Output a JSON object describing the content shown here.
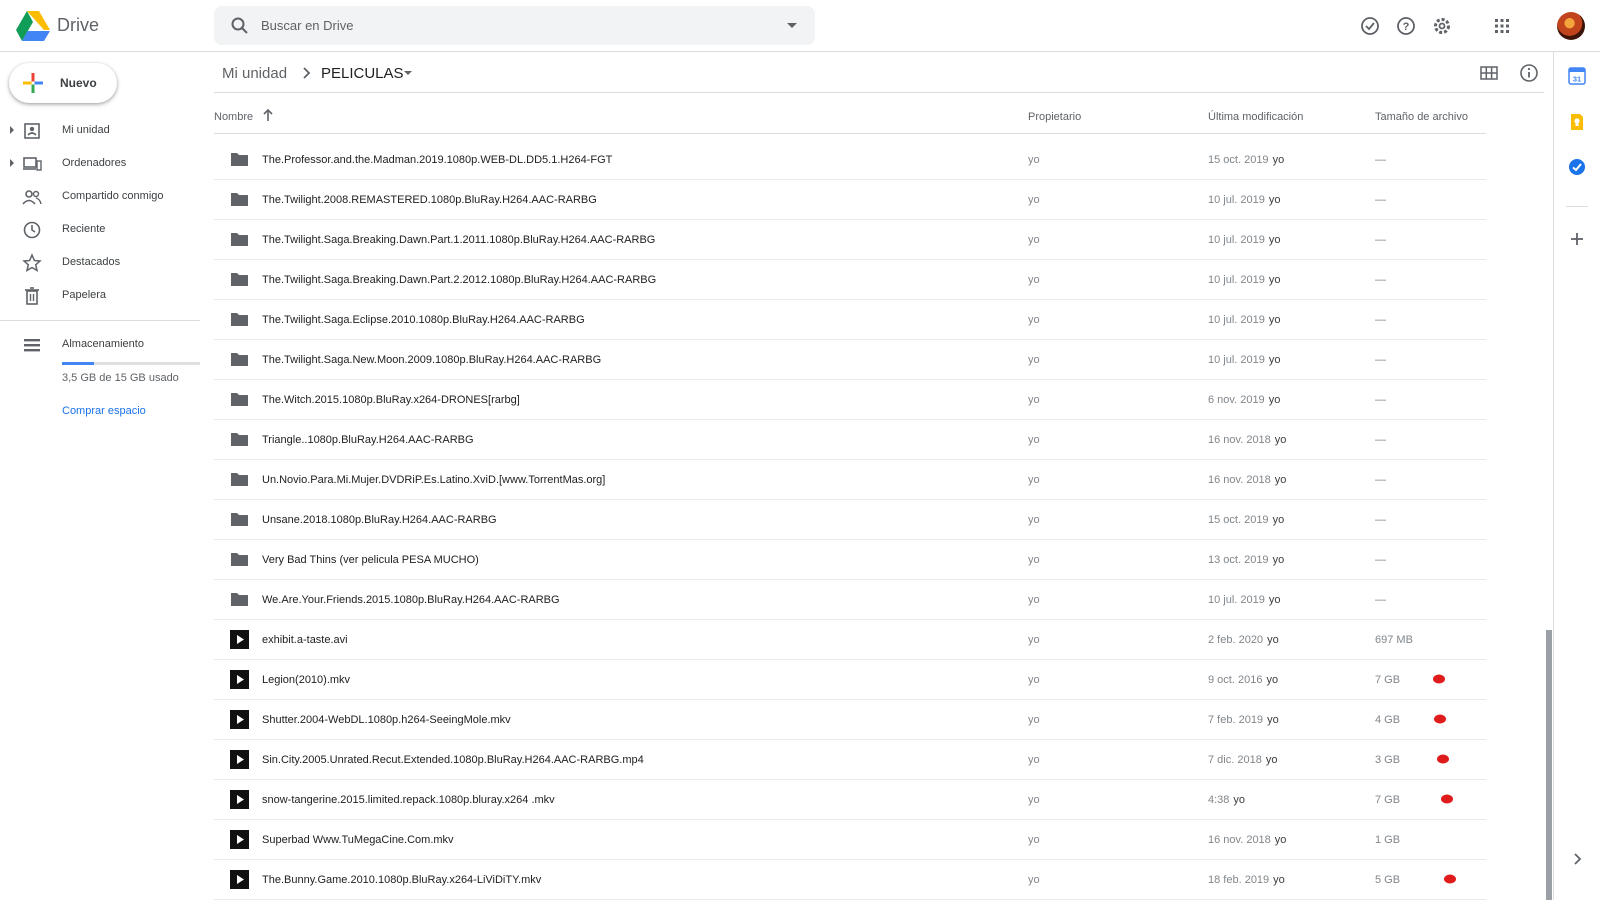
{
  "header": {
    "app_name": "Drive",
    "search_placeholder": "Buscar en Drive",
    "icons": [
      "support-check-icon",
      "help-icon",
      "settings-gear-icon",
      "apps-grid-icon",
      "account-avatar"
    ]
  },
  "sidebar": {
    "new_button": "Nuevo",
    "items": [
      {
        "label": "Mi unidad",
        "icon": "my-drive-icon",
        "expandable": true
      },
      {
        "label": "Ordenadores",
        "icon": "computers-icon",
        "expandable": true
      },
      {
        "label": "Compartido conmigo",
        "icon": "shared-people-icon",
        "expandable": false
      },
      {
        "label": "Reciente",
        "icon": "clock-icon",
        "expandable": false
      },
      {
        "label": "Destacados",
        "icon": "star-icon",
        "expandable": false
      },
      {
        "label": "Papelera",
        "icon": "trash-icon",
        "expandable": false
      }
    ],
    "storage": {
      "label": "Almacenamiento",
      "used_text": "3,5 GB de 15 GB usado",
      "used_fraction": 0.23,
      "buy_link": "Comprar espacio"
    }
  },
  "breadcrumb": {
    "root": "Mi unidad",
    "current": "PELICULAS"
  },
  "columns": {
    "name": "Nombre",
    "owner": "Propietario",
    "modified": "Última modificación",
    "size": "Tamaño de archivo"
  },
  "files": [
    {
      "type": "folder",
      "name": "The.Professor.and.the.Madman.2019.1080p.WEB-DL.DD5.1.H264-FGT",
      "owner": "yo",
      "date": "15 oct. 2019",
      "by": "yo",
      "size": "—"
    },
    {
      "type": "folder",
      "name": "The.Twilight.2008.REMASTERED.1080p.BluRay.H264.AAC-RARBG",
      "owner": "yo",
      "date": "10 jul. 2019",
      "by": "yo",
      "size": "—"
    },
    {
      "type": "folder",
      "name": "The.Twilight.Saga.Breaking.Dawn.Part.1.2011.1080p.BluRay.H264.AAC-RARBG",
      "owner": "yo",
      "date": "10 jul. 2019",
      "by": "yo",
      "size": "—"
    },
    {
      "type": "folder",
      "name": "The.Twilight.Saga.Breaking.Dawn.Part.2.2012.1080p.BluRay.H264.AAC-RARBG",
      "owner": "yo",
      "date": "10 jul. 2019",
      "by": "yo",
      "size": "—"
    },
    {
      "type": "folder",
      "name": "The.Twilight.Saga.Eclipse.2010.1080p.BluRay.H264.AAC-RARBG",
      "owner": "yo",
      "date": "10 jul. 2019",
      "by": "yo",
      "size": "—"
    },
    {
      "type": "folder",
      "name": "The.Twilight.Saga.New.Moon.2009.1080p.BluRay.H264.AAC-RARBG",
      "owner": "yo",
      "date": "10 jul. 2019",
      "by": "yo",
      "size": "—"
    },
    {
      "type": "folder",
      "name": "The.Witch.2015.1080p.BluRay.x264-DRONES[rarbg]",
      "owner": "yo",
      "date": "6 nov. 2019",
      "by": "yo",
      "size": "—"
    },
    {
      "type": "folder",
      "name": "Triangle..1080p.BluRay.H264.AAC-RARBG",
      "owner": "yo",
      "date": "16 nov. 2018",
      "by": "yo",
      "size": "—"
    },
    {
      "type": "folder",
      "name": "Un.Novio.Para.Mi.Mujer.DVDRiP.Es.Latino.XviD.[www.TorrentMas.org]",
      "owner": "yo",
      "date": "16 nov. 2018",
      "by": "yo",
      "size": "—"
    },
    {
      "type": "folder",
      "name": "Unsane.2018.1080p.BluRay.H264.AAC-RARBG",
      "owner": "yo",
      "date": "15 oct. 2019",
      "by": "yo",
      "size": "—"
    },
    {
      "type": "folder",
      "name": "Very Bad Thins (ver pelicula PESA MUCHO)",
      "owner": "yo",
      "date": "13 oct. 2019",
      "by": "yo",
      "size": "—"
    },
    {
      "type": "folder",
      "name": "We.Are.Your.Friends.2015.1080p.BluRay.H264.AAC-RARBG",
      "owner": "yo",
      "date": "10 jul. 2019",
      "by": "yo",
      "size": "—"
    },
    {
      "type": "video",
      "name": "exhibit.a-taste.avi",
      "owner": "yo",
      "date": "2 feb. 2020",
      "by": "yo",
      "size": "697 MB",
      "marked": false
    },
    {
      "type": "video",
      "name": "Legion(2010).mkv",
      "owner": "yo",
      "date": "9 oct. 2016",
      "by": "yo",
      "size": "7 GB",
      "marked": true
    },
    {
      "type": "video",
      "name": "Shutter.2004-WebDL.1080p.h264-SeeingMole.mkv",
      "owner": "yo",
      "date": "7 feb. 2019",
      "by": "yo",
      "size": "4 GB",
      "marked": true
    },
    {
      "type": "video",
      "name": "Sin.City.2005.Unrated.Recut.Extended.1080p.BluRay.H264.AAC-RARBG.mp4",
      "owner": "yo",
      "date": "7 dic. 2018",
      "by": "yo",
      "size": "3 GB",
      "marked": true
    },
    {
      "type": "video",
      "name": "snow-tangerine.2015.limited.repack.1080p.bluray.x264 .mkv",
      "owner": "yo",
      "date": "4:38",
      "by": "yo",
      "size": "7 GB",
      "marked": true
    },
    {
      "type": "video",
      "name": "Superbad Www.TuMegaCine.Com.mkv",
      "owner": "yo",
      "date": "16 nov. 2018",
      "by": "yo",
      "size": "1 GB",
      "marked": false
    },
    {
      "type": "video",
      "name": "The.Bunny.Game.2010.1080p.BluRay.x264-LiViDiTY.mkv",
      "owner": "yo",
      "date": "18 feb. 2019",
      "by": "yo",
      "size": "5 GB",
      "marked": true
    }
  ],
  "side_panel": {
    "icons": [
      "calendar-icon",
      "keep-icon",
      "tasks-icon",
      "add-addon-icon",
      "expand-panel-icon"
    ],
    "calendar_day": "31"
  },
  "colors": {
    "accent": "#1a73e8",
    "folder": "#5f6368",
    "mark": "#e01b1b",
    "storage_fill": "#4285f4"
  }
}
